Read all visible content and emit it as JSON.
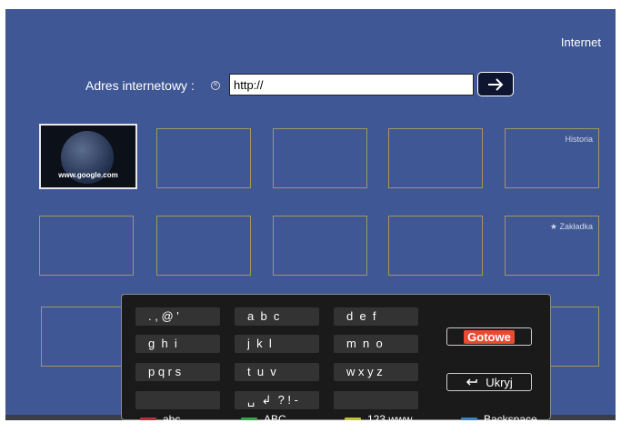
{
  "header": {
    "title": "Internet"
  },
  "address": {
    "label": "Adres internetowy :",
    "value": "http://"
  },
  "thumbnail": {
    "caption": "www.google.com"
  },
  "tiles": {
    "history_label": "Historia",
    "bookmark_label": "★ Zakładka"
  },
  "keyboard": {
    "keys": [
      [
        ". , @ '",
        "a  b  c",
        "d  e  f"
      ],
      [
        "g  h  i",
        "j  k  l",
        "m  n  o"
      ],
      [
        "p q r s",
        "t  u  v",
        "w x y z"
      ],
      [
        "",
        "␣  ↲  ? ! -",
        ""
      ]
    ],
    "done_label": "Gotowe",
    "hide_label": "Ukryj",
    "legend": [
      {
        "label": "abc",
        "color": "#b5333f"
      },
      {
        "label": "ABC",
        "color": "#3aa64a"
      },
      {
        "label": "123 www",
        "color": "#c8bf3a"
      },
      {
        "label": "Backspace",
        "color": "#3d86c6"
      }
    ]
  }
}
